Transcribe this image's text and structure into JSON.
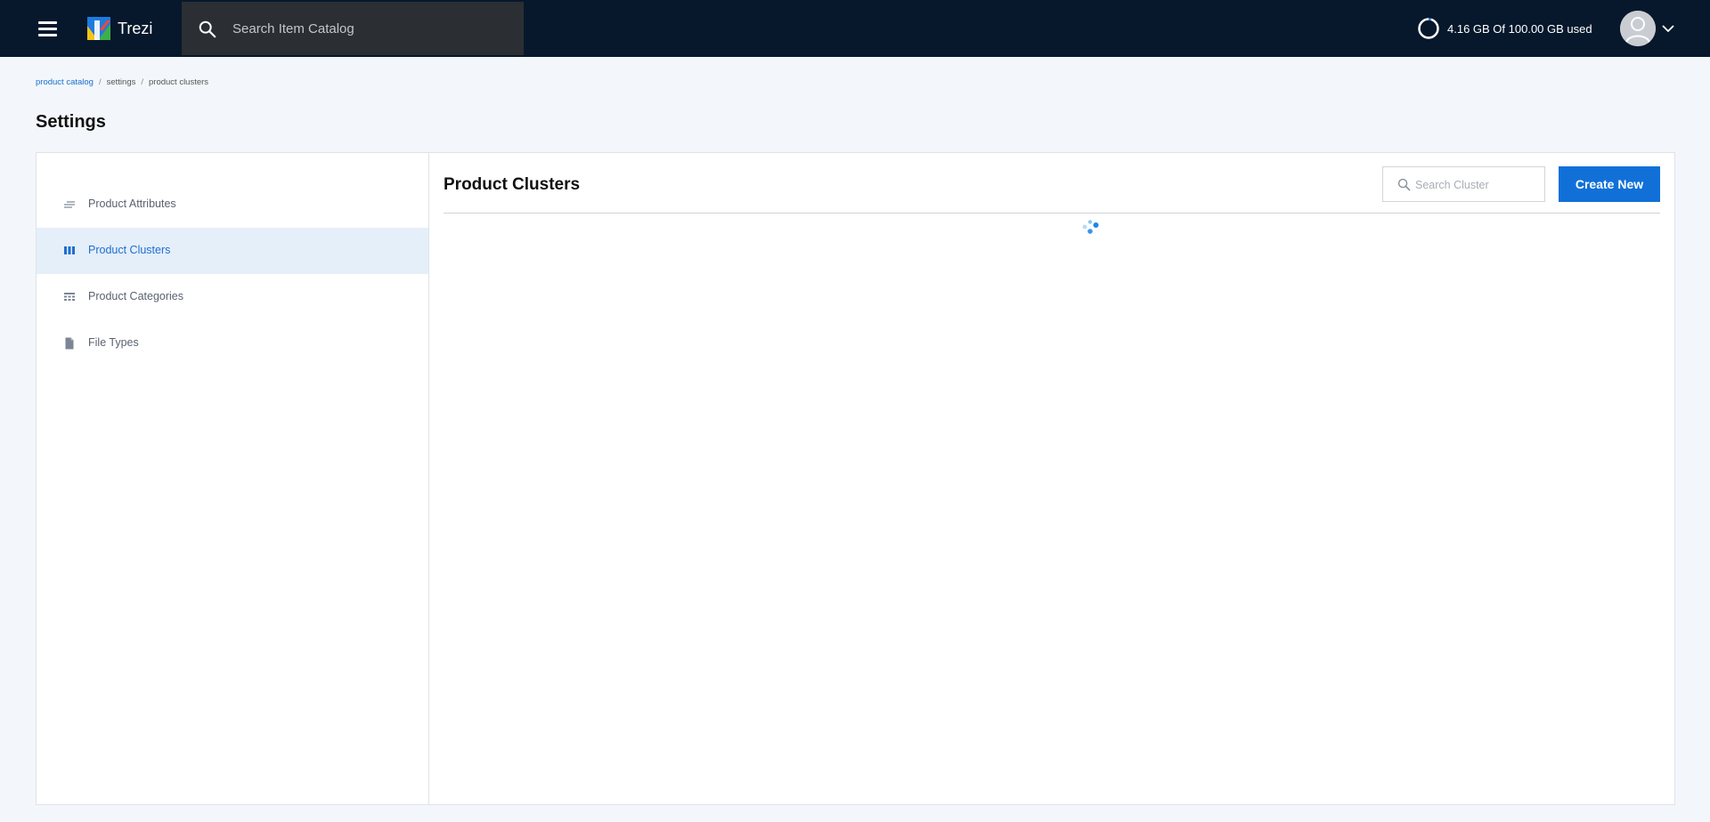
{
  "topbar": {
    "brand_name": "Trezi",
    "search_placeholder": "Search Item Catalog",
    "storage_text": "4.16 GB Of 100.00 GB used",
    "storage_used_fraction": 0.0416
  },
  "breadcrumb": {
    "items": [
      "product catalog",
      "settings",
      "product clusters"
    ],
    "separator": "/"
  },
  "page": {
    "title": "Settings"
  },
  "sidebar": {
    "items": [
      {
        "label": "Product Attributes",
        "icon": "lines-icon",
        "active": false
      },
      {
        "label": "Product Clusters",
        "icon": "columns-icon",
        "active": true
      },
      {
        "label": "Product Categories",
        "icon": "table-icon",
        "active": false
      },
      {
        "label": "File Types",
        "icon": "file-icon",
        "active": false
      }
    ]
  },
  "content": {
    "title": "Product Clusters",
    "search_placeholder": "Search Cluster",
    "create_label": "Create New",
    "loading": true
  },
  "colors": {
    "topbar_bg": "#07182c",
    "accent": "#1170d8",
    "active_item_bg": "#e5effa",
    "page_bg": "#f3f7fb"
  }
}
